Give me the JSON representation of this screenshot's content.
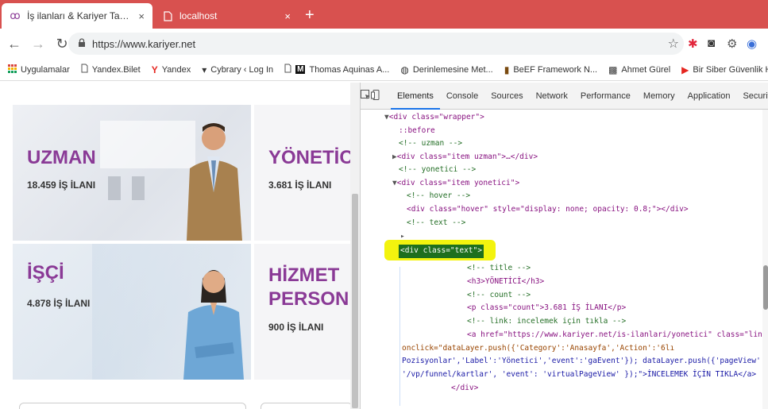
{
  "browser": {
    "tabs": [
      {
        "title": "İş ilanları & Kariyer Tavsiyeleri Ka",
        "active": true
      },
      {
        "title": "localhost",
        "active": false
      }
    ],
    "new_tab": "+",
    "close": "×",
    "url": "https://www.kariyer.net",
    "bookmarks": [
      {
        "label": "Uygulamalar",
        "icon": "apps-grid-icon"
      },
      {
        "label": "Yandex.Bilet",
        "icon": "page-icon"
      },
      {
        "label": "Yandex",
        "icon": "yandex-icon"
      },
      {
        "label": "Cybrary ‹ Log In",
        "icon": "cybrary-icon"
      },
      {
        "label": "Thomas Aquinas A...",
        "icon": "m-icon"
      },
      {
        "label": "Derinlemesine Met...",
        "icon": "globe-icon"
      },
      {
        "label": "BeEF Framework N...",
        "icon": "beef-icon"
      },
      {
        "label": "Ahmet Gürel",
        "icon": "avatar-icon"
      },
      {
        "label": "Bir Siber Güvenlik H...",
        "icon": "youtube-icon"
      }
    ]
  },
  "page": {
    "cards": [
      {
        "title": "UZMAN",
        "count": "18.459 İŞ İLANI"
      },
      {
        "title": "YÖNETİCİ",
        "count": "3.681 İŞ İLANI"
      },
      {
        "title": "İŞÇİ",
        "count": "4.878 İŞ İLANI"
      },
      {
        "title_line1": "HİZMET",
        "title_line2": "PERSONELİ",
        "count": "900 İŞ İLANI"
      }
    ]
  },
  "devtools": {
    "tabs": [
      "Elements",
      "Console",
      "Sources",
      "Network",
      "Performance",
      "Memory",
      "Application",
      "Security"
    ],
    "more": "»",
    "dom": {
      "l1_tag": "<div class=\"wrapper\">",
      "l2": "::before",
      "l3": "<!-- uzman -->",
      "l4": "<div class=\"item uzman\">…</div>",
      "l5": "<!-- yonetici -->",
      "l6": "<div class=\"item yonetici\">",
      "l7": "<!-- hover -->",
      "l8": "<div class=\"hover\" style=\"display: none; opacity: 0.8;\"></div>",
      "l9": "<!-- text -->",
      "l10": "<div class=\"text\">",
      "l11": "<!-- title -->",
      "l12": "<h3>YÖNETİCİ</h3>",
      "l13": "<!-- count -->",
      "l14": "<p class=\"count\">3.681 İŞ İLANI</p>",
      "l15": "<!-- link: incelemek için tıkla -->",
      "l16": "<a href=\"https://www.kariyer.net/is-ilanlari/yonetici\" class=\"link\"",
      "l17": "onclick=\"dataLayer.push({'Category':'Anasayfa','Action':'6lı",
      "l18": "Pozisyonlar','Label':'Yönetici','event':'gaEvent'}); dataLayer.push({'pageView':",
      "l19": "'/vp/funnel/kartlar', 'event': 'virtualPageView' });\">İNCELEMEK İÇİN TIKLA</a>",
      "l20": "</div>"
    }
  }
}
